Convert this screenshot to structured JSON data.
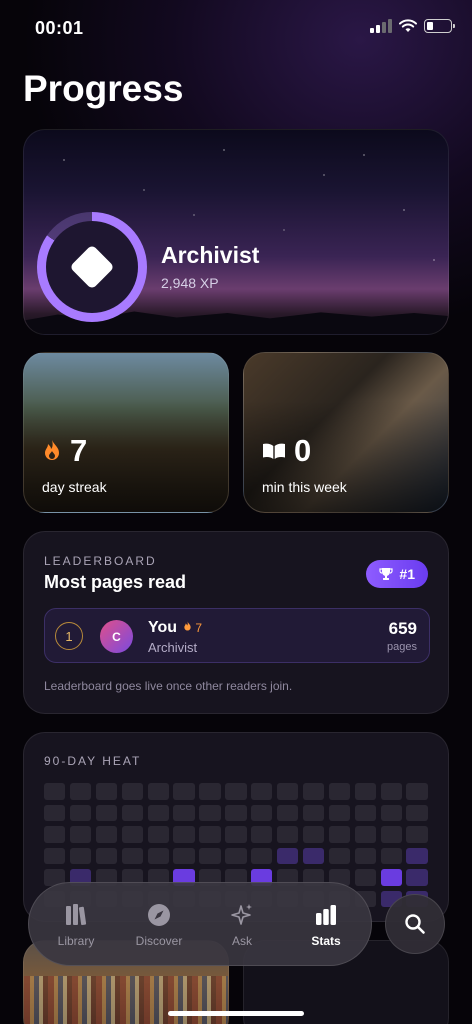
{
  "status_bar": {
    "time": "00:01"
  },
  "page": {
    "title": "Progress"
  },
  "rank_card": {
    "rank_name": "Archivist",
    "xp": "2,948 XP",
    "level_progress": 0.85
  },
  "tiles": {
    "streak": {
      "value": "7",
      "caption": "day streak",
      "icon": "flame-icon"
    },
    "reading": {
      "value": "0",
      "caption": "min this week",
      "icon": "open-book-icon"
    }
  },
  "leaderboard": {
    "kicker": "LEADERBOARD",
    "title": "Most pages read",
    "badge": "#1",
    "entry": {
      "place": "1",
      "initial": "C",
      "name": "You",
      "streak": "7",
      "rank": "Archivist",
      "pages_value": "659",
      "pages_unit": "pages"
    },
    "note": "Leaderboard goes live once other readers join."
  },
  "heat": {
    "kicker": "90-DAY HEAT"
  },
  "nav": {
    "items": [
      {
        "label": "Library",
        "icon": "library-icon"
      },
      {
        "label": "Discover",
        "icon": "compass-icon"
      },
      {
        "label": "Ask",
        "icon": "sparkles-icon"
      },
      {
        "label": "Stats",
        "icon": "bar-chart-icon"
      }
    ],
    "active": "Stats",
    "search_icon": "search-icon"
  },
  "colors": {
    "accent": "#8e5cff",
    "streak": "#ff9a3c",
    "heat_active": "#6a3ce0"
  }
}
